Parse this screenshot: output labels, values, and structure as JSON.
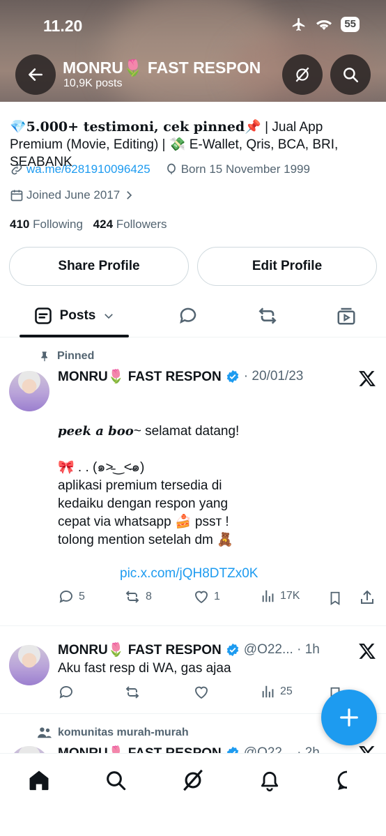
{
  "status_bar": {
    "time": "11.20",
    "battery": "55"
  },
  "header": {
    "name": "MONRU🌷 FAST RESPON",
    "posts_count": "10,9K posts"
  },
  "profile": {
    "bio_bold": "💎5.000+ testimoni, cek pinned📌",
    "bio_rest": " | Jual App Premium (Movie, Editing) | 💸 E-Wallet, Qris, BCA, BRI, SEABANK",
    "link": "wa.me/6281910096425",
    "birthday": "Born 15 November 1999",
    "joined": "Joined June 2017",
    "following_count": "410",
    "following_label": "Following",
    "followers_count": "424",
    "followers_label": "Followers",
    "share_button": "Share Profile",
    "edit_button": "Edit Profile"
  },
  "tabs": {
    "posts_label": "Posts"
  },
  "posts": [
    {
      "context": "Pinned",
      "name": "MONRU🌷 FAST RESPON",
      "meta": "· 20/01/23",
      "text_italic": "peek a boo",
      "text_line1_rest": "~ selamat datang!",
      "text_line2": "🎀 . . (๑˃̵‿˂̵๑)",
      "text_line3": "aplikasi  premium  tersedia di",
      "text_line4": "kedaiku dengan  respon yang",
      "text_line5": "cepat via  whatsapp 🍰 pѕѕт !",
      "text_line6": "tolong mention setelah dm 🧸",
      "link": "pic.x.com/jQH8DTZx0K",
      "replies": "5",
      "reposts": "8",
      "likes": "1",
      "views": "17K"
    },
    {
      "name": "MONRU🌷 FAST RESPON",
      "meta": "@O22... · 1h",
      "text": "Aku fast resp di WA, gas ajaa",
      "views": "25"
    },
    {
      "context": "komunitas murah-murah",
      "name": "MONRU🌷 FAST RESPON",
      "meta": "@O22... · 2h"
    }
  ],
  "colors": {
    "accent": "#1d9bf0",
    "text": "#0f1419",
    "muted": "#536471"
  }
}
